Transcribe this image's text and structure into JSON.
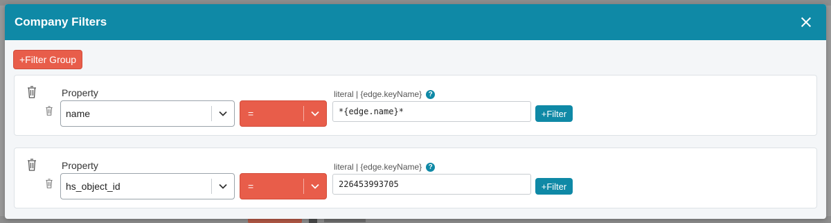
{
  "modal": {
    "title": "Company Filters",
    "add_group_label": "+Filter Group"
  },
  "groups": [
    {
      "property_label": "Property",
      "property_value": "name",
      "operator": "=",
      "literal_label": "literal | {edge.keyName}",
      "literal_value": "*{edge.name}*",
      "help": "?",
      "add_filter_label": "+Filter"
    },
    {
      "property_label": "Property",
      "property_value": "hs_object_id",
      "operator": "=",
      "literal_label": "literal | {edge.keyName}",
      "literal_value": "226453993705",
      "help": "?",
      "add_filter_label": "+Filter"
    }
  ],
  "icons": {
    "close": "close-icon",
    "trash": "trash-icon",
    "chevron": "chevron-down-icon",
    "help": "help-icon"
  },
  "colors": {
    "header": "#0f89a6",
    "accent_red": "#e85d4a"
  }
}
